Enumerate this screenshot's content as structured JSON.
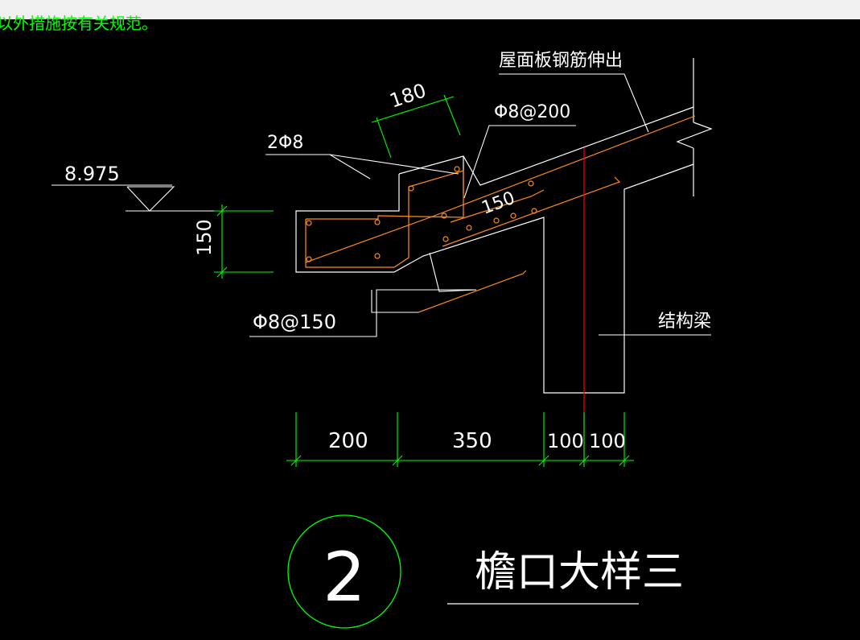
{
  "header": {
    "note_text": "以外措施按有关规范。"
  },
  "labels": {
    "elevation": "8.975",
    "roof_rebar_extend": "屋面板钢筋伸出",
    "structural_beam": "结构梁",
    "top_bars": "2Φ8",
    "stirrup_upper": "Φ8@200",
    "stirrup_lower": "Φ8@150",
    "detail_number": "2",
    "detail_title": "檐口大样三"
  },
  "dimensions": {
    "slant_180": "180",
    "slant_150": "150",
    "vertical_150": "150",
    "bottom": [
      "200",
      "350",
      "100",
      "100"
    ]
  },
  "colors": {
    "background": "#000000",
    "outline": "#ffffff",
    "dimension": "#00ff00",
    "rebar": "#ff8c1a",
    "axis": "#ff0000",
    "topbar": "#f0f0f0"
  }
}
